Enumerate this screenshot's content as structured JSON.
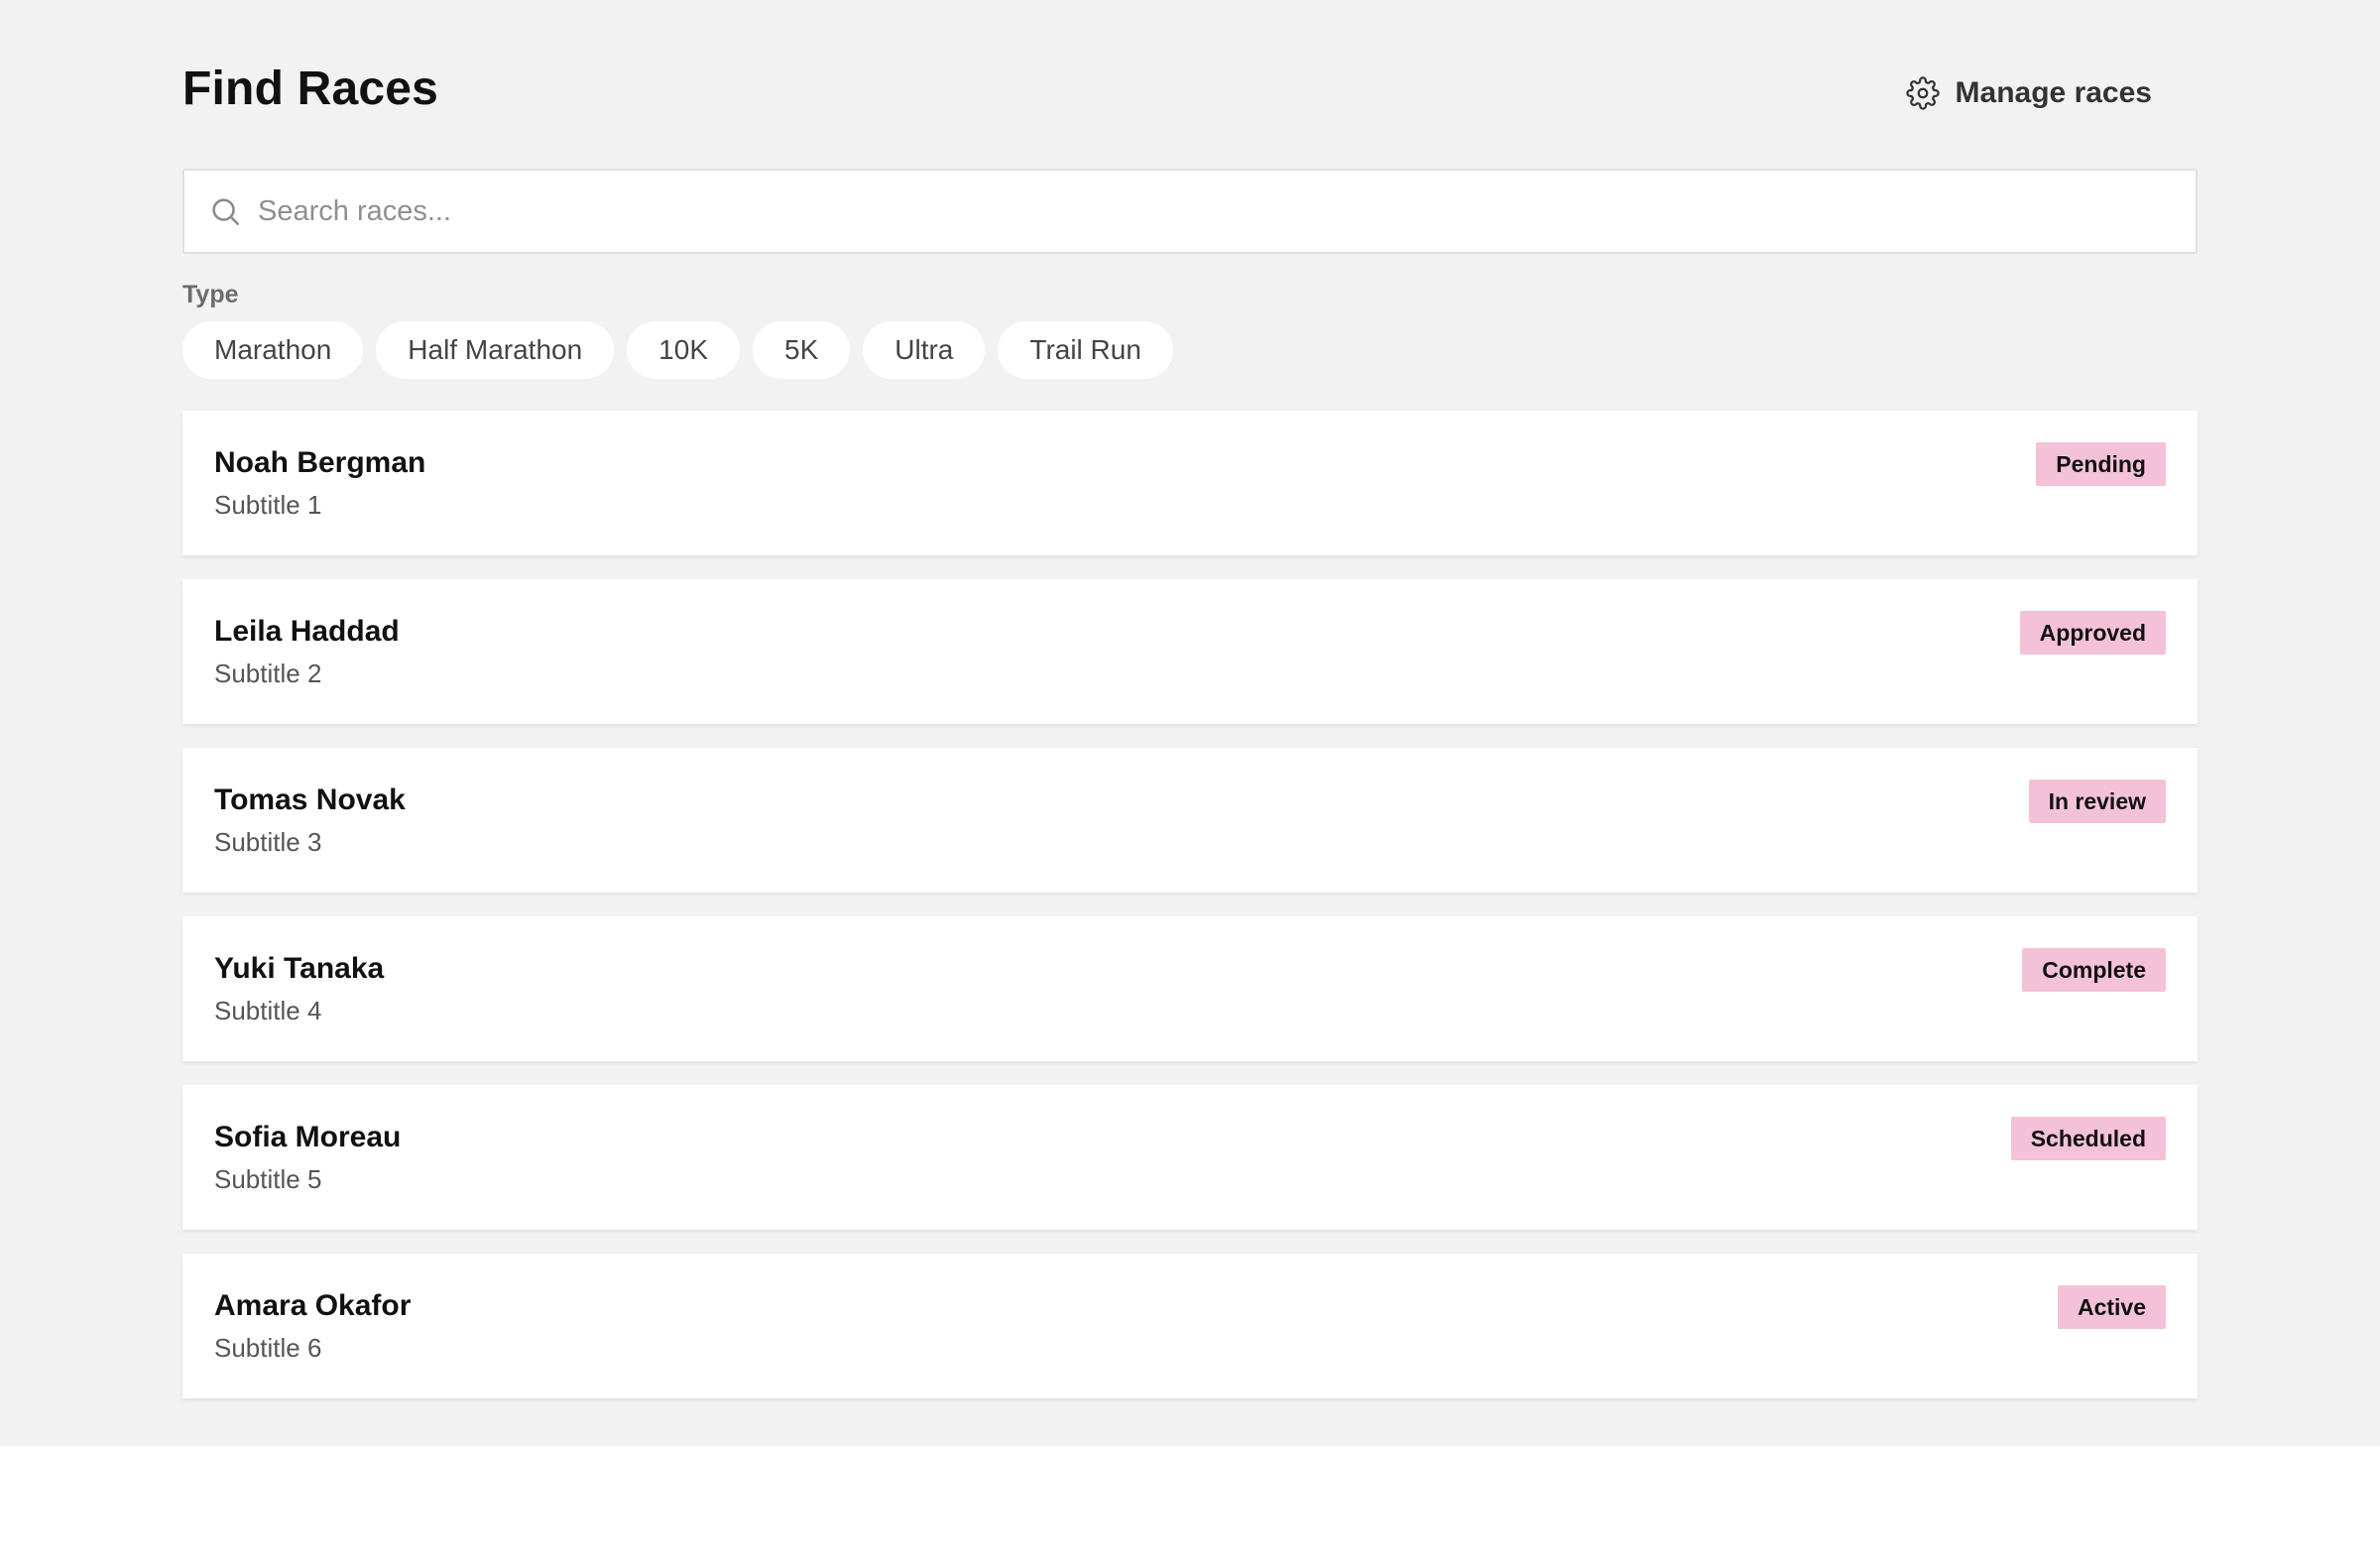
{
  "header": {
    "title": "Find Races",
    "manage_label": "Manage races",
    "manage_icon": "gear-icon"
  },
  "search": {
    "placeholder": "Search races...",
    "value": "",
    "icon": "search-icon"
  },
  "filters": {
    "label": "Type",
    "chips": [
      "Marathon",
      "Half Marathon",
      "10K",
      "5K",
      "Ultra",
      "Trail Run"
    ]
  },
  "badge_color": "#f4c2d8",
  "races": [
    {
      "name": "Noah Bergman",
      "subtitle": "Subtitle 1",
      "status": "Pending"
    },
    {
      "name": "Leila Haddad",
      "subtitle": "Subtitle 2",
      "status": "Approved"
    },
    {
      "name": "Tomas Novak",
      "subtitle": "Subtitle 3",
      "status": "In review"
    },
    {
      "name": "Yuki Tanaka",
      "subtitle": "Subtitle 4",
      "status": "Complete"
    },
    {
      "name": "Sofia Moreau",
      "subtitle": "Subtitle 5",
      "status": "Scheduled"
    },
    {
      "name": "Amara Okafor",
      "subtitle": "Subtitle 6",
      "status": "Active"
    }
  ]
}
